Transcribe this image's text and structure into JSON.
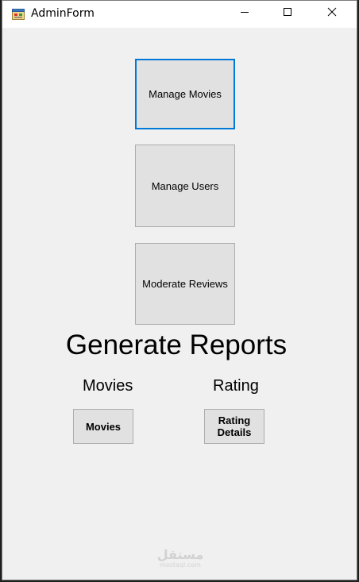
{
  "window": {
    "title": "AdminForm"
  },
  "buttons": {
    "manage_movies": "Manage Movies",
    "manage_users": "Manage Users",
    "moderate_reviews": "Moderate Reviews"
  },
  "reports": {
    "heading": "Generate Reports",
    "movies_label": "Movies",
    "rating_label": "Rating",
    "movies_button": "Movies",
    "rating_button": "Rating\nDetails"
  },
  "watermark": {
    "main": "مستقل",
    "sub": "mostaql.com"
  },
  "icons": {
    "app": "form-app-icon",
    "minimize": "minimize-icon",
    "maximize": "maximize-icon",
    "close": "close-icon"
  },
  "colors": {
    "focus_border": "#0078d7",
    "window_bg": "#f0f0f0",
    "button_bg": "#e1e1e1"
  }
}
